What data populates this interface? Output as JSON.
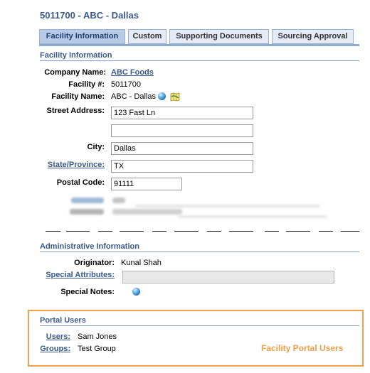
{
  "page": {
    "title": "5011700 - ABC - Dallas"
  },
  "tabs": [
    {
      "label": "Facility Information",
      "active": true
    },
    {
      "label": "Custom",
      "active": false
    },
    {
      "label": "Supporting Documents",
      "active": false
    },
    {
      "label": "Sourcing Approval",
      "active": false
    }
  ],
  "facility_section": {
    "header": "Facility Information",
    "company_name_label": "Company Name:",
    "company_name_value": "ABC Foods",
    "facility_number_label": "Facility #:",
    "facility_number_value": "5011700",
    "facility_name_label": "Facility Name:",
    "facility_name_value": "ABC - Dallas",
    "street_address_label": "Street Address:",
    "street_address_line1": "123 Fast Ln",
    "street_address_line2": "",
    "city_label": "City:",
    "city_value": "Dallas",
    "state_label": "State/Province:",
    "state_value": "TX",
    "postal_code_label": "Postal Code:",
    "postal_code_value": "91111"
  },
  "admin_section": {
    "header": "Administrative Information",
    "originator_label": "Originator:",
    "originator_value": "Kunal Shah",
    "special_attributes_label": "Special Attributes:",
    "special_attributes_value": "",
    "special_notes_label": "Special Notes:"
  },
  "portal_section": {
    "header": "Portal Users",
    "users_label": "Users:",
    "users_value": "Sam Jones",
    "groups_label": "Groups:",
    "groups_value": "Test Group"
  },
  "callout": {
    "text": "Facility Portal Users"
  },
  "colors": {
    "accent_blue": "#3a5a8c",
    "tab_active": "#b8cbe6",
    "tab_inactive": "#e4ebf5",
    "highlight_orange": "#f0a04b"
  },
  "icons": {
    "facility_name_globe": "globe-icon",
    "facility_name_map": "map-icon",
    "special_notes": "globe-icon"
  }
}
